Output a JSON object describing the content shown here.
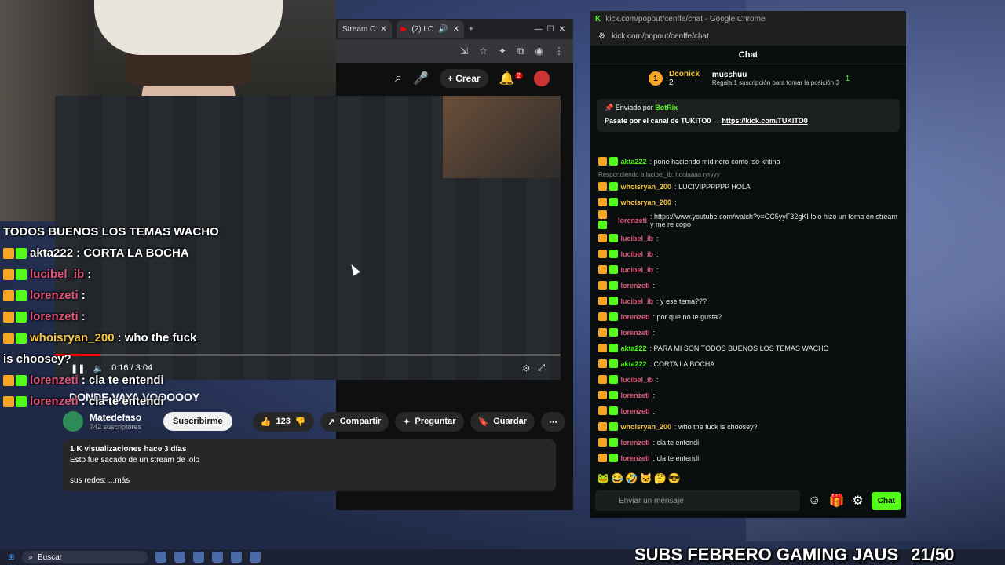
{
  "overlay_chat": [
    {
      "user": "",
      "text": "TODOS BUENOS LOS TEMAS WACHO",
      "user_color": "#ffffff"
    },
    {
      "user": "akta222",
      "text": ": CORTA LA BOCHA",
      "user_color": "#ffffff"
    },
    {
      "user": "lucibel_ib",
      "text": ":",
      "user_color": "#e05577"
    },
    {
      "user": "lorenzeti",
      "text": ":",
      "user_color": "#e05577"
    },
    {
      "user": "lorenzeti",
      "text": ":",
      "user_color": "#e05577"
    },
    {
      "user": "whoisryan_200",
      "text": ": who the fuck",
      "user_color": "#f5c542"
    },
    {
      "user": "",
      "text": "is choosey?",
      "user_color": "#ffffff"
    },
    {
      "user": "lorenzeti",
      "text": ": cla te entendi",
      "user_color": "#e05577"
    },
    {
      "user": "lorenzeti",
      "text": ": cla te entendi",
      "user_color": "#e05577"
    }
  ],
  "youtube": {
    "tabs": [
      "Stream C",
      "(2) LC"
    ],
    "create_label": "Crear",
    "notifications": "2",
    "time": "0:16 / 3:04",
    "progress": 0.09,
    "overlay_title": "DONDE VAYA VOOOOOY",
    "channel_name": "Matedefaso",
    "subscribers": "742 suscriptores",
    "subscribe_label": "Suscribirme",
    "likes": "123",
    "share_label": "Compartir",
    "ask_label": "Preguntar",
    "save_label": "Guardar",
    "desc_meta": "1 K visualizaciones  hace 3 días",
    "desc_text": "Esto fue sacado de un stream de lolo",
    "desc_more": "sus redes: ...más"
  },
  "kick": {
    "window_title": "kick.com/popout/cenffe/chat - Google Chrome",
    "url": "kick.com/popout/cenffe/chat",
    "header": "Chat",
    "leader1_name": "Dconick",
    "leader1_count": "2",
    "leader2_name": "musshuu",
    "leader2_sub": "Regala 1 suscripción para tomar la posición 3",
    "leader_count": "1",
    "pinned_by": "Enviado por",
    "pinned_user": "BotRix",
    "pinned_text": "Pasate por el canal de TUKITO0 →",
    "pinned_link": "https://kick.com/TUKITO0",
    "messages": [
      {
        "user": "akta222",
        "text": ": pone haciendo midinero como iso kritina",
        "color": "#53fc18"
      },
      {
        "reply": "Respondiendo a lucibel_ib: hoolaaaa ryryyy"
      },
      {
        "user": "whoisryan_200",
        "text": ": LUCIVIPPPPPP HOLA",
        "color": "#f5c542"
      },
      {
        "user": "whoisryan_200",
        "text": ":",
        "color": "#f5c542"
      },
      {
        "user": "lorenzeti",
        "text": ": https://www.youtube.com/watch?v=CC5yyF32gKI lolo hizo un tema en stream y me re copo",
        "color": "#e05577"
      },
      {
        "user": "lucibel_ib",
        "text": ":",
        "color": "#e05577"
      },
      {
        "user": "lucibel_ib",
        "text": ":",
        "color": "#e05577"
      },
      {
        "user": "lucibel_ib",
        "text": ":",
        "color": "#e05577"
      },
      {
        "user": "lorenzeti",
        "text": ":",
        "color": "#e05577"
      },
      {
        "user": "lucibel_ib",
        "text": ": y ese tema???",
        "color": "#e05577"
      },
      {
        "user": "lorenzeti",
        "text": ": por que no te gusta?",
        "color": "#e05577"
      },
      {
        "user": "lorenzeti",
        "text": ":",
        "color": "#e05577"
      },
      {
        "user": "akta222",
        "text": ": PARA MI SON TODOS BUENOS LOS TEMAS WACHO",
        "color": "#53fc18"
      },
      {
        "user": "akta222",
        "text": ": CORTA LA BOCHA",
        "color": "#53fc18"
      },
      {
        "user": "lucibel_ib",
        "text": ":",
        "color": "#e05577"
      },
      {
        "user": "lorenzeti",
        "text": ":",
        "color": "#e05577"
      },
      {
        "user": "lorenzeti",
        "text": ":",
        "color": "#e05577"
      },
      {
        "user": "whoisryan_200",
        "text": ": who the fuck is choosey?",
        "color": "#f5c542"
      },
      {
        "user": "lorenzeti",
        "text": ": cla te entendi",
        "color": "#e05577"
      },
      {
        "user": "lorenzeti",
        "text": ": cla te entendi",
        "color": "#e05577"
      }
    ],
    "input_placeholder": "Enviar un mensaje",
    "chat_button": "Chat"
  },
  "taskbar": {
    "search": "Buscar"
  },
  "banner": "SUBS FEBRERO GAMING JAUS",
  "banner_count": "21/50"
}
